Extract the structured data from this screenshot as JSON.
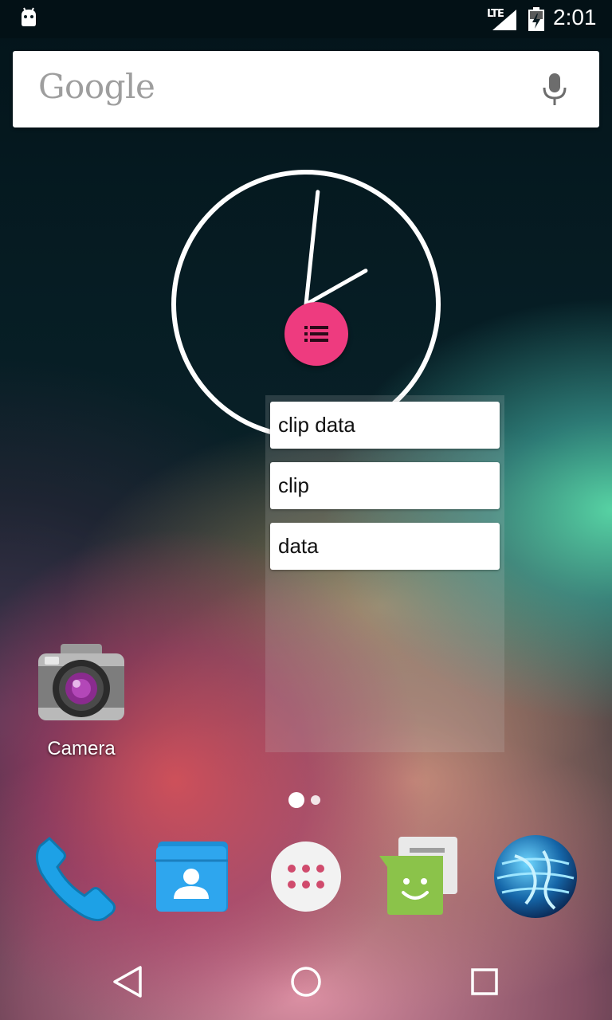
{
  "status_bar": {
    "network": "LTE",
    "time": "2:01",
    "icons": [
      "android-icon",
      "signal-icon",
      "battery-icon"
    ]
  },
  "search_bar": {
    "logo_text": "Google",
    "mic": "mic-icon"
  },
  "clock": {
    "type": "analog",
    "hour": 2,
    "minute": 1
  },
  "fab": {
    "icon": "list-icon",
    "color": "#ee3b7f"
  },
  "clip_panel": {
    "items": [
      {
        "label": "clip data"
      },
      {
        "label": "clip"
      },
      {
        "label": "data"
      }
    ]
  },
  "home_apps": [
    {
      "label": "Camera",
      "icon": "camera-icon"
    }
  ],
  "page_indicator": {
    "pages": 2,
    "current": 1
  },
  "dock": [
    {
      "name": "phone",
      "icon": "phone-icon"
    },
    {
      "name": "contacts",
      "icon": "contacts-icon"
    },
    {
      "name": "app-drawer",
      "icon": "app-drawer-icon"
    },
    {
      "name": "messenger",
      "icon": "messenger-icon"
    },
    {
      "name": "browser",
      "icon": "globe-icon"
    }
  ],
  "nav_bar": {
    "buttons": [
      "back-icon",
      "home-icon",
      "recents-icon"
    ]
  },
  "colors": {
    "accent": "#ee3b7f",
    "phone": "#1da1e6",
    "contacts": "#2196f3",
    "messenger": "#8bc34a"
  }
}
